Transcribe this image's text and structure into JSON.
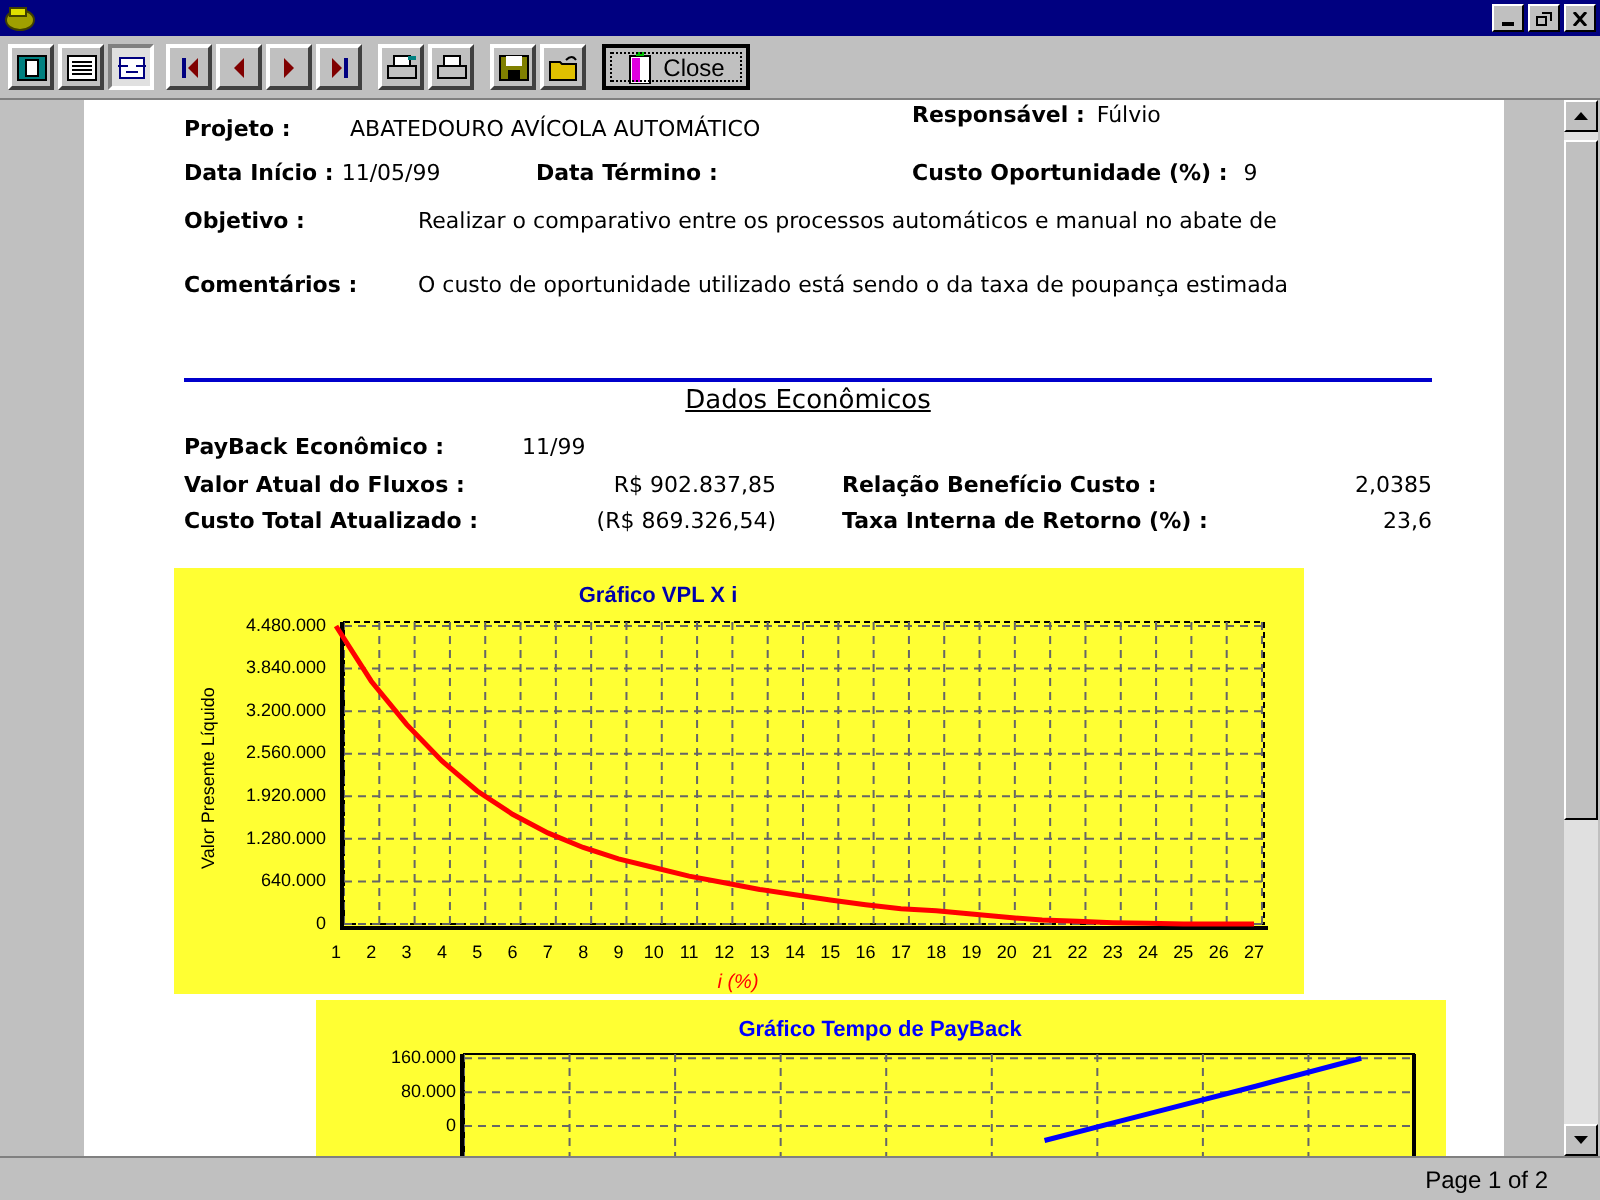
{
  "toolbar": {
    "view_buttons": [
      {
        "selected": false
      },
      {
        "selected": false
      },
      {
        "selected": true
      }
    ],
    "close_button": {
      "label": "Close"
    }
  },
  "report": {
    "responsavel": {
      "label": "Responsável :",
      "value": "Fúlvio"
    },
    "projeto": {
      "label": "Projeto :",
      "value": "ABATEDOURO AVÍCOLA AUTOMÁTICO"
    },
    "data_inicio": {
      "label": "Data Início :",
      "value": "11/05/99"
    },
    "data_termino": {
      "label": "Data Término :"
    },
    "custo_oportunidade": {
      "label": "Custo Oportunidade (%) :",
      "value": "9"
    },
    "objetivo": {
      "label": "Objetivo :",
      "value": "Realizar o comparativo entre os processos automáticos e manual no abate de"
    },
    "comentarios": {
      "label": "Comentários :",
      "value": "O custo de oportunidade utilizado está sendo o da taxa de poupança estimada"
    },
    "section_title": "Dados Econômicos",
    "payback": {
      "label": "PayBack Econômico :",
      "value": "11/99"
    },
    "economics": [
      {
        "label": "Valor Atual do Fluxos :",
        "value": "R$ 902.837,85",
        "label_2": "Relação Benefício Custo :",
        "value_2": "2,0385"
      },
      {
        "label": "Custo Total Atualizado :",
        "value": "(R$ 869.326,54)",
        "label_2": "Taxa Interna de Retorno (%) :",
        "value_2": "23,6"
      }
    ],
    "vpl_chart": {
      "chart_data": {
        "type": "line",
        "title": "Gráfico VPL X i",
        "xlabel": "i (%)",
        "ylabel": "Valor Presente Líquido",
        "x": [
          1,
          2,
          3,
          4,
          5,
          6,
          7,
          8,
          9,
          10,
          11,
          12,
          13,
          14,
          15,
          16,
          17,
          18,
          19,
          20,
          21,
          22,
          23,
          24,
          25,
          26,
          27
        ],
        "series": [
          {
            "color": "#ff0000",
            "values": [
              4480000,
              3650000,
              3000000,
              2450000,
              2000000,
              1650000,
              1370000,
              1150000,
              980000,
              850000,
              720000,
              620000,
              520000,
              440000,
              360000,
              290000,
              230000,
              200000,
              150000,
              100000,
              60000,
              40000,
              20000,
              10000,
              0,
              0,
              0
            ]
          }
        ],
        "ylim": [
          0,
          4480000
        ],
        "grid": true,
        "yticks": [
          {
            "value": 0,
            "label": "0"
          },
          {
            "value": 640000,
            "label": "640.000"
          },
          {
            "value": 1280000,
            "label": "1.280.000"
          },
          {
            "value": 1920000,
            "label": "1.920.000"
          },
          {
            "value": 2560000,
            "label": "2.560.000"
          },
          {
            "value": 3200000,
            "label": "3.200.000"
          },
          {
            "value": 3840000,
            "label": "3.840.000"
          },
          {
            "value": 4480000,
            "label": "4.480.000"
          }
        ]
      }
    },
    "payback_chart": {
      "chart_data": {
        "type": "line",
        "title": "Gráfico Tempo de PayBack",
        "series": [
          {
            "color": "#0000ff",
            "values": [
              null,
              null,
              null,
              null,
              null,
              -34000,
              30000,
              94000,
              160000
            ]
          }
        ],
        "categories": [
          null,
          null,
          null,
          null,
          null,
          null,
          null,
          null,
          null
        ],
        "ylim": [
          -80000,
          170000
        ],
        "grid": true,
        "yticks": [
          {
            "value": 0,
            "label": "0"
          },
          {
            "value": 80000,
            "label": "80.000"
          },
          {
            "value": 160000,
            "label": "160.000"
          }
        ]
      }
    }
  },
  "status_bar": {
    "page": "Page 1 of 2"
  }
}
